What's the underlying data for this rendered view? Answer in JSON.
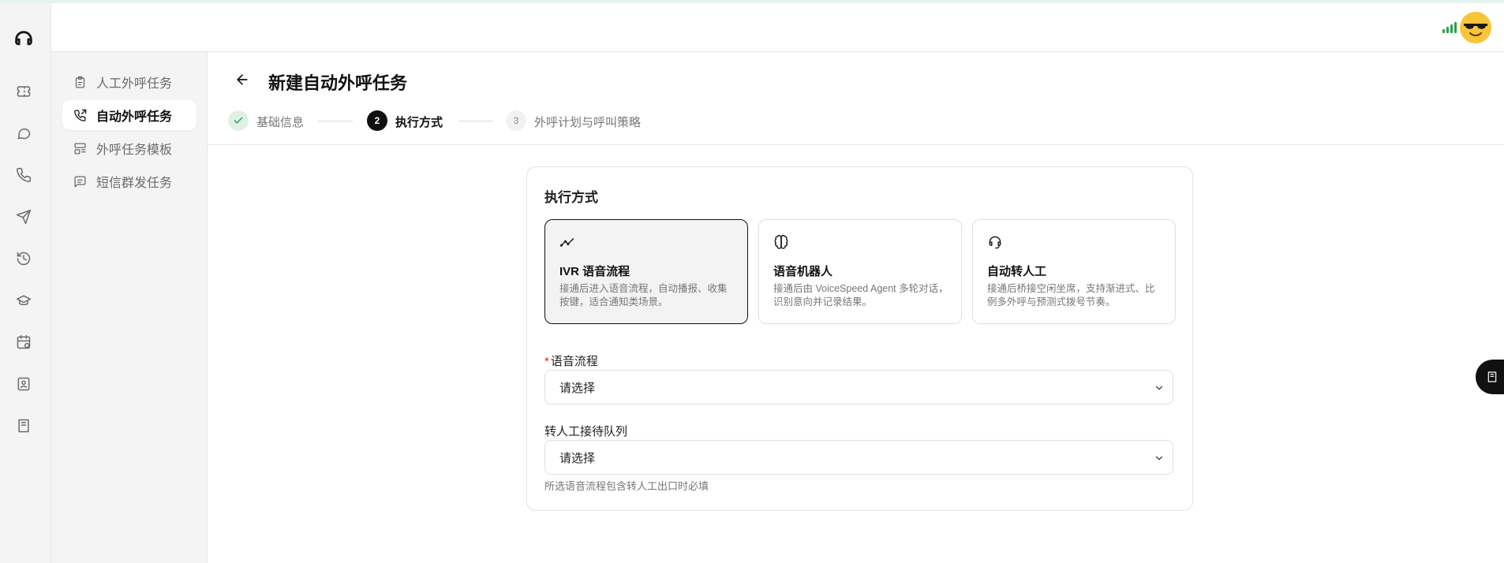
{
  "rail": {
    "items": [
      {
        "icon": "headset-logo-icon"
      },
      {
        "icon": "ticket-icon"
      },
      {
        "icon": "chat-bubble-icon"
      },
      {
        "icon": "phone-icon"
      },
      {
        "icon": "send-icon"
      },
      {
        "icon": "history-icon"
      },
      {
        "icon": "graduation-cap-icon"
      },
      {
        "icon": "calendar-clock-icon"
      },
      {
        "icon": "contacts-book-icon"
      },
      {
        "icon": "book-icon"
      }
    ]
  },
  "subnav": {
    "items": [
      {
        "label": "人工外呼任务",
        "icon": "clipboard-icon",
        "active": false
      },
      {
        "label": "自动外呼任务",
        "icon": "phone-outgoing-icon",
        "active": true
      },
      {
        "label": "外呼任务模板",
        "icon": "layout-template-icon",
        "active": false
      },
      {
        "label": "短信群发任务",
        "icon": "message-square-icon",
        "active": false
      }
    ]
  },
  "header": {
    "signal_color": "#27a344",
    "avatar": "sunglasses-emoji"
  },
  "page": {
    "title": "新建自动外呼任务",
    "steps": [
      {
        "number": "✓",
        "label": "基础信息",
        "state": "done"
      },
      {
        "number": "2",
        "label": "执行方式",
        "state": "current"
      },
      {
        "number": "3",
        "label": "外呼计划与呼叫策略",
        "state": "pending"
      }
    ]
  },
  "card": {
    "title": "执行方式",
    "options": [
      {
        "icon": "trend-line-icon",
        "title": "IVR 语音流程",
        "desc": "接通后进入语音流程，自动播报、收集按键，适合通知类场景。",
        "selected": true
      },
      {
        "icon": "brain-icon",
        "title": "语音机器人",
        "desc": "接通后由 VoiceSpeed Agent 多轮对话，识别意向并记录结果。",
        "selected": false
      },
      {
        "icon": "headset-icon",
        "title": "自动转人工",
        "desc": "接通后桥接空闲坐席，支持渐进式、比例多外呼与预测式拨号节奏。",
        "selected": false
      }
    ],
    "voice_flow": {
      "required_mark": "*",
      "label": "语音流程",
      "value": "请选择"
    },
    "queue": {
      "label": "转人工接待队列",
      "value": "请选择",
      "hint": "所选语音流程包含转人工出口时必填"
    }
  },
  "colors": {
    "accent": "#111111",
    "success_step": "#dff1e4",
    "required": "#e02424"
  }
}
